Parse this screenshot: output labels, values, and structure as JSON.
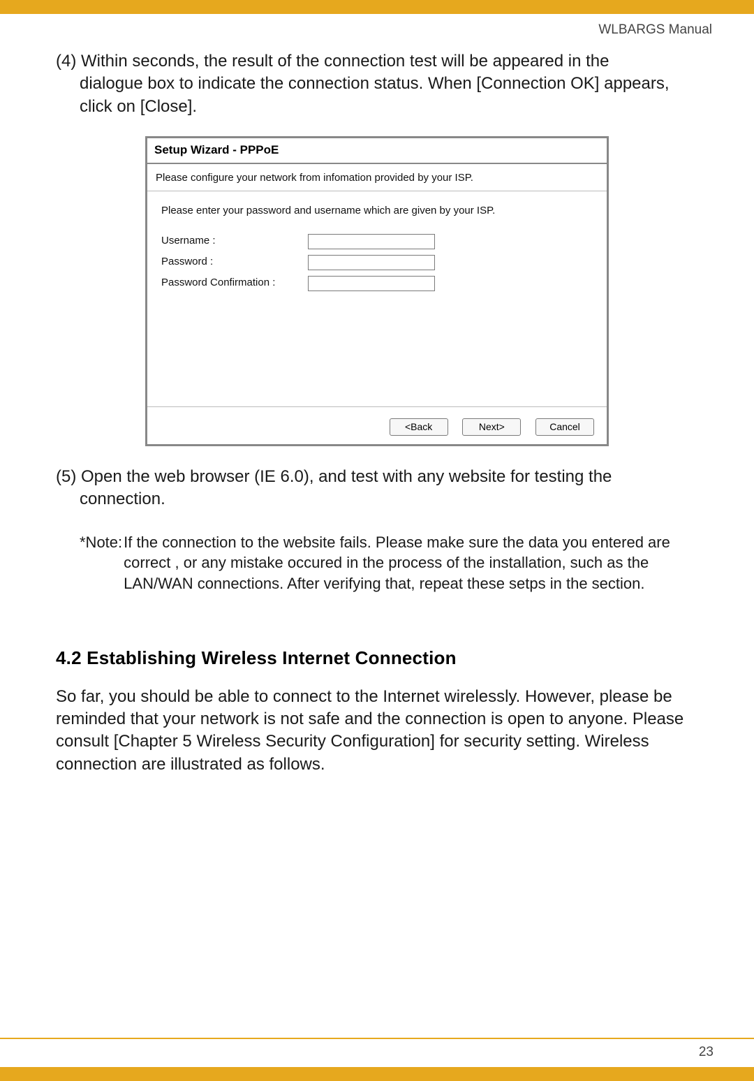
{
  "header": {
    "manual_label": "WLBARGS Manual"
  },
  "step4": {
    "num": "(4) ",
    "text": "Within seconds, the result of the connection test will be appeared in the dialogue box to indicate the connection status. When [Connection OK] appears, click on [Close]."
  },
  "wizard": {
    "title": "Setup Wizard - PPPoE",
    "subtitle": "Please configure your network from infomation provided by your ISP.",
    "instruction": "Please enter your password and username which are given by your ISP.",
    "labels": {
      "username": "Username :",
      "password": "Password :",
      "password_confirm": "Password Confirmation :"
    },
    "buttons": {
      "back": "<Back",
      "next": "Next>",
      "cancel": "Cancel"
    }
  },
  "step5": {
    "num": "(5) ",
    "text": "Open the web browser (IE 6.0), and test with any website for testing the connection."
  },
  "note": {
    "label": "*Note: ",
    "text": "If the connection to the website fails. Please make sure the data you entered are correct , or any mistake occured in the process of the installation, such as the LAN/WAN connections. After verifying that, repeat these setps in the section."
  },
  "section42": {
    "heading": "4.2 Establishing Wireless Internet Connection",
    "body": "So far, you should be able to connect to the Internet wirelessly. However, please be reminded that your network is not safe and the connection is open to anyone. Please consult [Chapter 5 Wireless Security Configuration] for security setting. Wireless connection are illustrated as follows."
  },
  "page_number": "23"
}
